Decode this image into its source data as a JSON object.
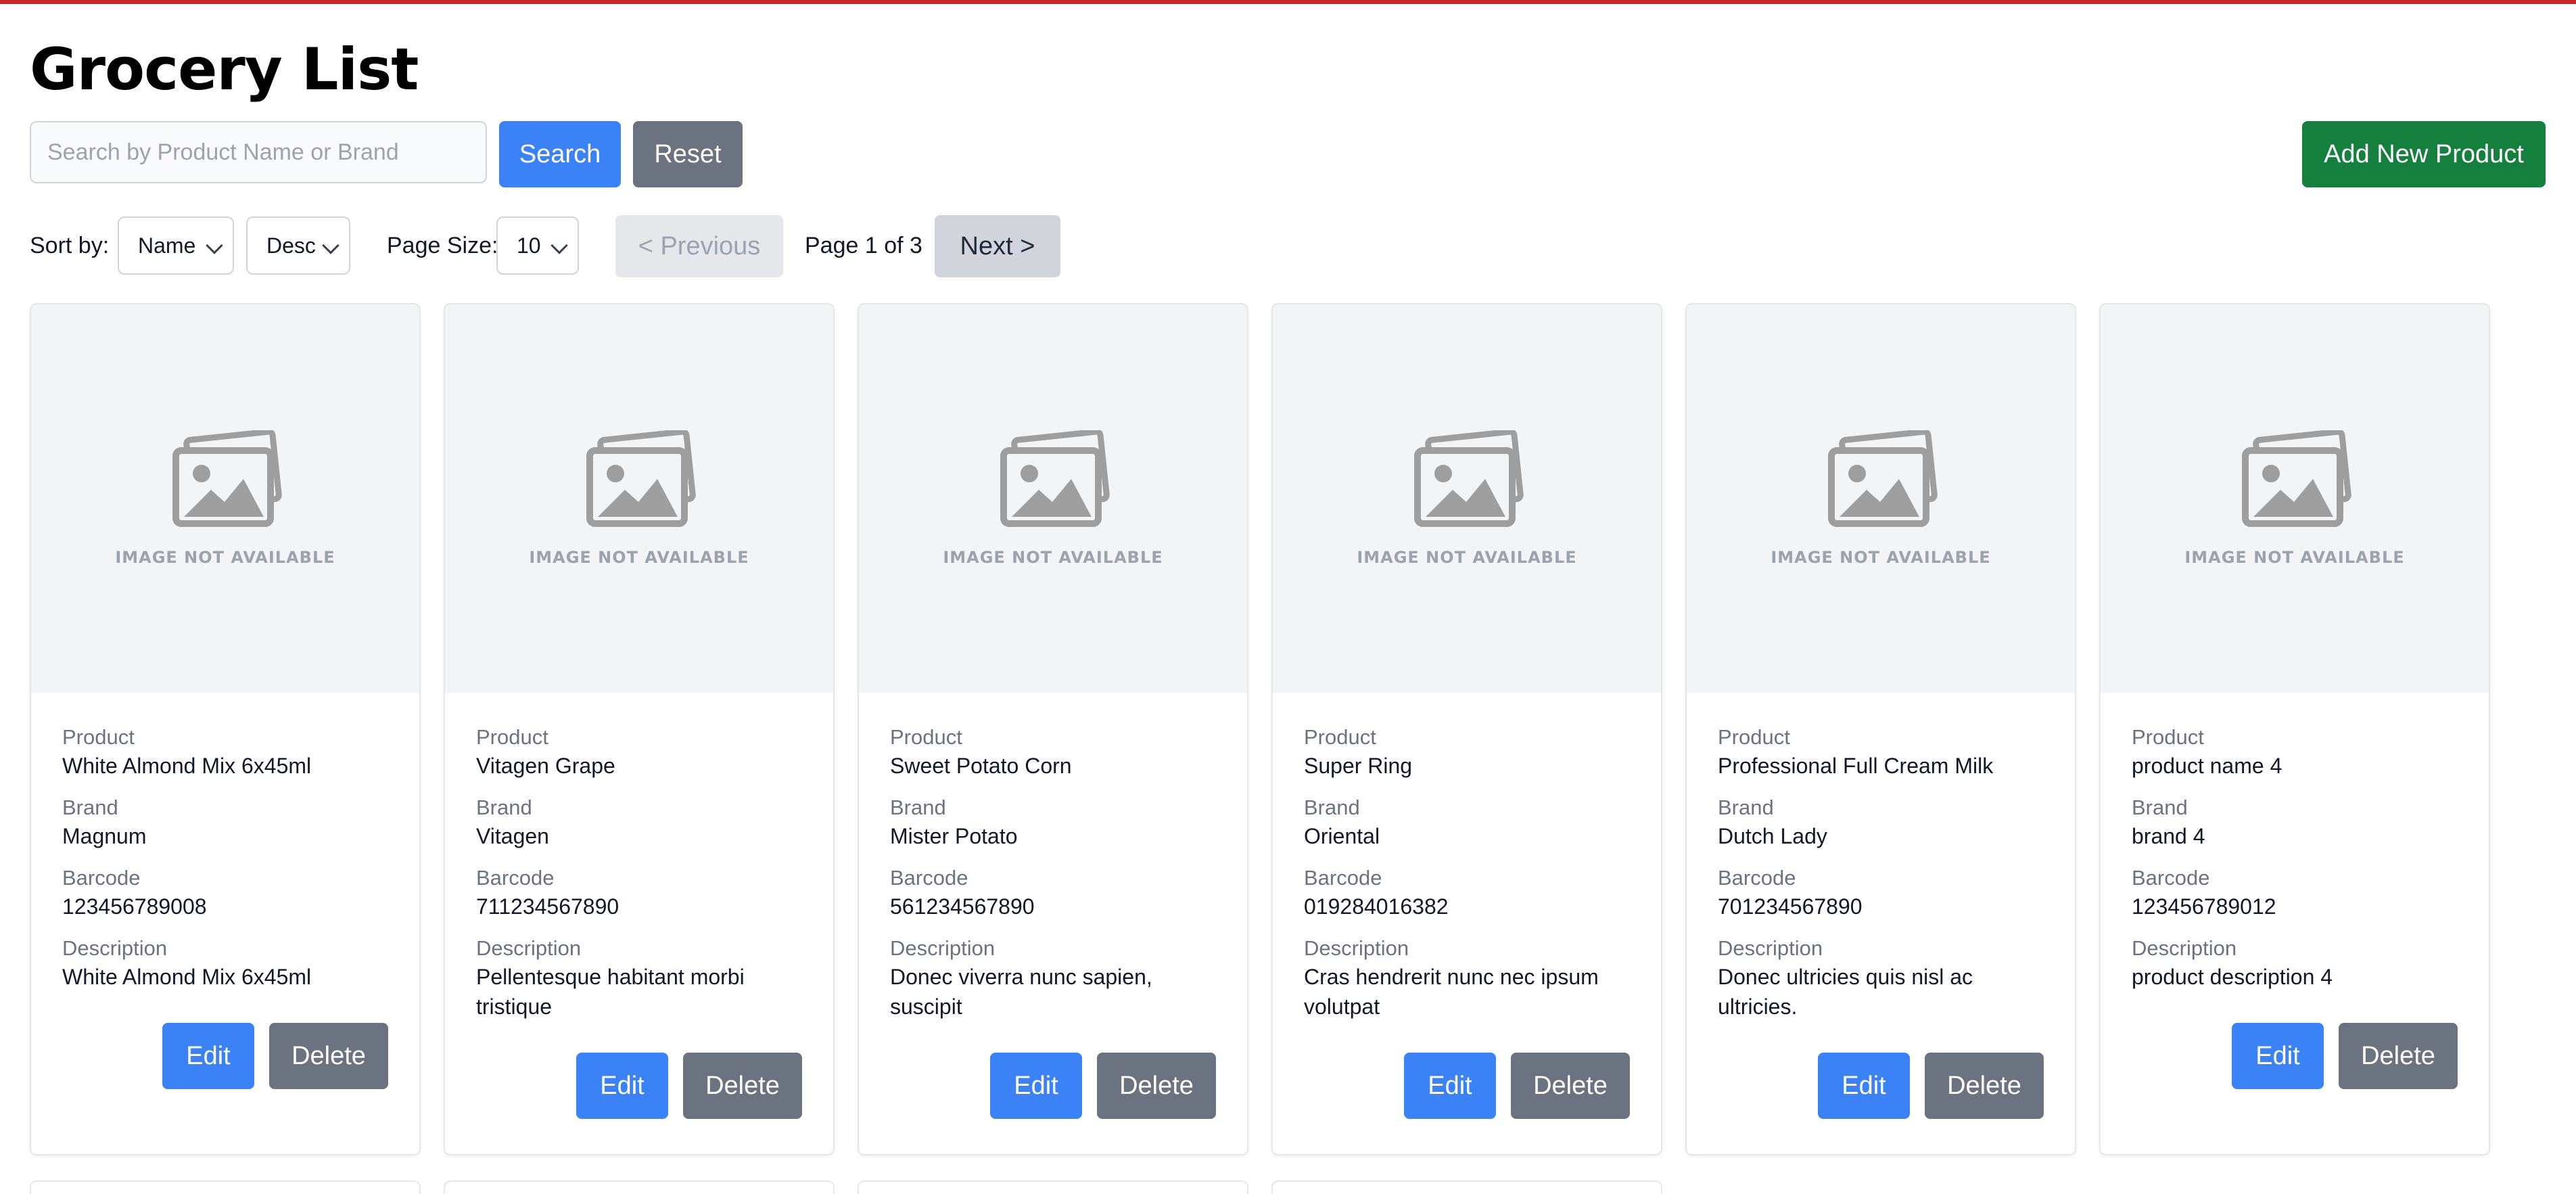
{
  "app": {
    "title": "Grocery List"
  },
  "search": {
    "placeholder": "Search by Product Name or Brand",
    "button_label": "Search",
    "reset_label": "Reset"
  },
  "actions": {
    "add_label": "Add New Product"
  },
  "controls": {
    "sort_label": "Sort by:",
    "sort_field": "Name",
    "sort_order": "Desc",
    "page_size_label": "Page Size:",
    "page_size": "10",
    "prev_label": "< Previous",
    "next_label": "Next >",
    "page_info": "Page 1 of 3"
  },
  "labels": {
    "product": "Product",
    "brand": "Brand",
    "barcode": "Barcode",
    "description": "Description",
    "image_placeholder": "IMAGE NOT AVAILABLE",
    "edit": "Edit",
    "delete": "Delete"
  },
  "products": [
    {
      "product": "White Almond Mix 6x45ml",
      "brand": "Magnum",
      "barcode": "123456789008",
      "description": "White Almond Mix 6x45ml"
    },
    {
      "product": "Vitagen Grape",
      "brand": "Vitagen",
      "barcode": "711234567890",
      "description": "Pellentesque habitant morbi tristique"
    },
    {
      "product": "Sweet Potato Corn",
      "brand": "Mister Potato",
      "barcode": "561234567890",
      "description": "Donec viverra nunc sapien, suscipit"
    },
    {
      "product": "Super Ring",
      "brand": "Oriental",
      "barcode": "019284016382",
      "description": "Cras hendrerit nunc nec ipsum volutpat"
    },
    {
      "product": "Professional Full Cream Milk",
      "brand": "Dutch Lady",
      "barcode": "701234567890",
      "description": "Donec ultricies quis nisl ac ultricies."
    },
    {
      "product": "product name 4",
      "brand": "brand 4",
      "barcode": "123456789012",
      "description": "product description 4"
    }
  ],
  "colors": {
    "primary": "#3b82f6",
    "secondary": "#6b7280",
    "success": "#15803d",
    "top_bar": "#c62828"
  },
  "icons": {
    "image_placeholder": "image-placeholder-icon",
    "select_chevron": "chevron-down-icon"
  }
}
